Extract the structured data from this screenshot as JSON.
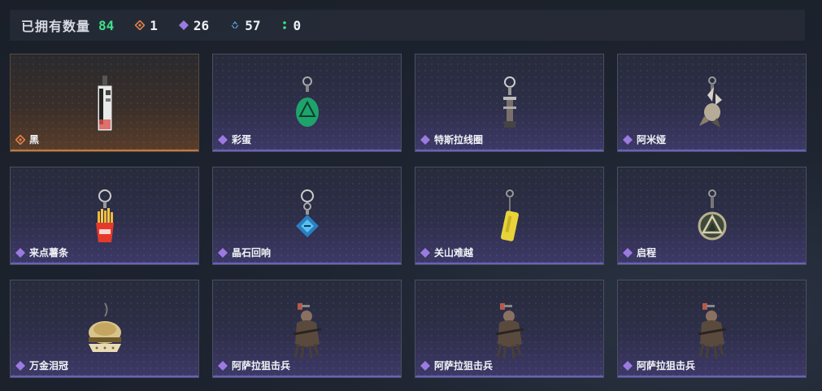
{
  "header": {
    "title": "已拥有数量",
    "total": "84",
    "stats": [
      {
        "icon": "orange-diamond-icon",
        "value": "1",
        "color": "#e0814a"
      },
      {
        "icon": "purple-diamond-icon",
        "value": "26",
        "color": "#9b7be0"
      },
      {
        "icon": "blue-chevrons-icon",
        "value": "57",
        "color": "#5da6e8"
      },
      {
        "icon": "green-dots-icon",
        "value": "0",
        "color": "#3ee08c"
      }
    ]
  },
  "items": [
    {
      "name": "黑",
      "rarity": "orange",
      "art": "black-tag-charm"
    },
    {
      "name": "彩蛋",
      "rarity": "purple",
      "art": "green-egg-charm"
    },
    {
      "name": "特斯拉线圈",
      "rarity": "purple",
      "art": "tesla-coil-charm"
    },
    {
      "name": "阿米娅",
      "rarity": "purple",
      "art": "amiya-charm"
    },
    {
      "name": "来点薯条",
      "rarity": "purple",
      "art": "fries-charm"
    },
    {
      "name": "晶石回响",
      "rarity": "purple",
      "art": "crystal-charm"
    },
    {
      "name": "关山难越",
      "rarity": "purple",
      "art": "yellow-bar-charm"
    },
    {
      "name": "启程",
      "rarity": "purple",
      "art": "triangle-disc-charm"
    },
    {
      "name": "万金泪冠",
      "rarity": "purple",
      "art": "burger-charm"
    },
    {
      "name": "阿萨拉狙击兵",
      "rarity": "purple",
      "art": "sniper-figure-charm"
    },
    {
      "name": "阿萨拉狙击兵",
      "rarity": "purple",
      "art": "sniper-figure-charm"
    },
    {
      "name": "阿萨拉狙击兵",
      "rarity": "purple",
      "art": "sniper-figure-charm"
    }
  ]
}
